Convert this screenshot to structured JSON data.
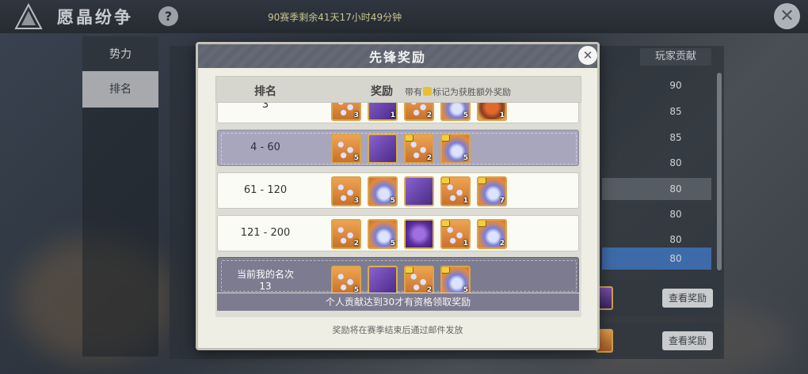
{
  "header": {
    "title": "愿晶纷争",
    "help_icon": "?",
    "season_timer": "90赛季剩余41天17小时49分钟",
    "close_icon": "✕"
  },
  "tabs": [
    {
      "label": "势力",
      "selected": false
    },
    {
      "label": "排名",
      "selected": true
    }
  ],
  "background_table": {
    "column_header": "玩家贡献",
    "values": [
      "90",
      "85",
      "85",
      "80",
      "80",
      "80",
      "80",
      "80"
    ],
    "view_reward_buttons": [
      "查看奖励",
      "查看奖励"
    ]
  },
  "modal": {
    "title": "先锋奖励",
    "close_icon": "✕",
    "header_rank": "排名",
    "header_reward": "奖励",
    "header_note_pre": "带有",
    "header_note_post": "标记为获胜额外奖励",
    "rows": [
      {
        "rank": "3",
        "items": [
          {
            "type": "drops",
            "count": "3",
            "winner": false
          },
          {
            "type": "cloth",
            "count": "1",
            "winner": false
          },
          {
            "type": "drops",
            "count": "2",
            "winner": false
          },
          {
            "type": "drop",
            "count": "5",
            "winner": false
          },
          {
            "type": "chest",
            "count": "1",
            "winner": false
          }
        ]
      },
      {
        "rank": "4 - 60",
        "items": [
          {
            "type": "drops",
            "count": "5",
            "winner": false
          },
          {
            "type": "cloth",
            "count": "",
            "winner": false
          },
          {
            "type": "drops",
            "count": "2",
            "winner": true
          },
          {
            "type": "drop",
            "count": "5",
            "winner": true
          }
        ]
      },
      {
        "rank": "61 - 120",
        "items": [
          {
            "type": "drops",
            "count": "3",
            "winner": false
          },
          {
            "type": "drop",
            "count": "5",
            "winner": false
          },
          {
            "type": "cloth",
            "count": "",
            "winner": false
          },
          {
            "type": "drops",
            "count": "1",
            "winner": true
          },
          {
            "type": "drop",
            "count": "7",
            "winner": true
          }
        ]
      },
      {
        "rank": "121 - 200",
        "items": [
          {
            "type": "drops",
            "count": "2",
            "winner": false
          },
          {
            "type": "drop",
            "count": "5",
            "winner": false
          },
          {
            "type": "purple",
            "count": "",
            "winner": false
          },
          {
            "type": "drops",
            "count": "1",
            "winner": true
          },
          {
            "type": "drop",
            "count": "2",
            "winner": true
          }
        ]
      }
    ],
    "my_rank_label": "当前我的名次",
    "my_rank_value": "13",
    "my_items": [
      {
        "type": "drops",
        "count": "5",
        "winner": false
      },
      {
        "type": "cloth",
        "count": "",
        "winner": false
      },
      {
        "type": "drops",
        "count": "2",
        "winner": true
      },
      {
        "type": "drop",
        "count": "5",
        "winner": true
      }
    ],
    "notice": "个人贡献达到30才有资格领取奖励",
    "footer": "奖励将在赛季结束后通过邮件发放"
  },
  "colors": {
    "modal_header": "#5f6470",
    "highlight_row": "#a8a6bd",
    "my_row": "#7d7b8f",
    "item_border": "#d9a54a",
    "winner_mark": "#f0cf3a"
  }
}
